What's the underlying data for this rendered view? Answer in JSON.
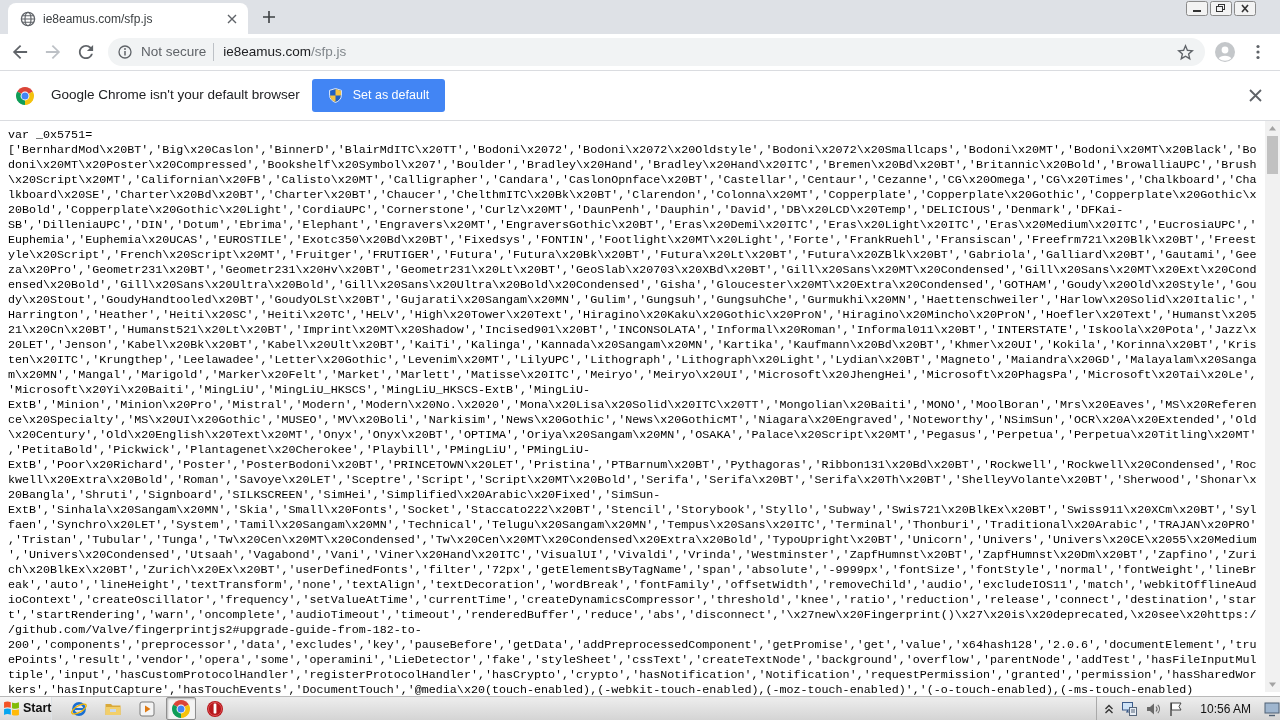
{
  "tabs": [
    {
      "title": "ie8eamus.com/sfp.js",
      "selected": true
    }
  ],
  "toolbar": {
    "nav_buttons": [
      {
        "kind": "back",
        "disabled": false
      },
      {
        "kind": "forward",
        "disabled": true
      },
      {
        "kind": "reload",
        "disabled": false
      }
    ],
    "address_bar": {
      "security_label": "Not secure",
      "host": "ie8eamus.com",
      "path": "/sfp.js"
    }
  },
  "infobar": {
    "message": "Google Chrome isn't your default browser",
    "button": "Set as default"
  },
  "document": {
    "lines": [
      "var _0x5751=",
      "['BernhardMod\\x20BT','Big\\x20Caslon','BinnerD','BlairMdITC\\x20TT','Bodoni\\x2072','Bodoni\\x2072\\x20Oldstyle','Bodoni\\x2072\\x20Smallcaps','Bodoni\\x20MT','Bodoni\\x20MT\\x20Black','Bo",
      "doni\\x20MT\\x20Poster\\x20Compressed','Bookshelf\\x20Symbol\\x207','Boulder','Bradley\\x20Hand','Bradley\\x20Hand\\x20ITC','Bremen\\x20Bd\\x20BT','Britannic\\x20Bold','BrowalliaUPC','Brush",
      "\\x20Script\\x20MT','Californian\\x20FB','Calisto\\x20MT','Calligrapher','Candara','CaslonOpnface\\x20BT','Castellar','Centaur','Cezanne','CG\\x20Omega','CG\\x20Times','Chalkboard','Cha",
      "lkboard\\x20SE','Charter\\x20Bd\\x20BT','Charter\\x20BT','Chaucer','ChelthmITC\\x20Bk\\x20BT','Clarendon','Colonna\\x20MT','Copperplate','Copperplate\\x20Gothic','Copperplate\\x20Gothic\\x",
      "20Bold','Copperplate\\x20Gothic\\x20Light','CordiaUPC','Cornerstone','Curlz\\x20MT','DaunPenh','Dauphin','David','DB\\x20LCD\\x20Temp','DELICIOUS','Denmark','DFKai-",
      "SB','DilleniaUPC','DIN','Dotum','Ebrima','Elephant','Engravers\\x20MT','EngraversGothic\\x20BT','Eras\\x20Demi\\x20ITC','Eras\\x20Light\\x20ITC','Eras\\x20Medium\\x20ITC','EucrosiaUPC','",
      "Euphemia','Euphemia\\x20UCAS','EUROSTILE','Exotc350\\x20Bd\\x20BT','Fixedsys','FONTIN','Footlight\\x20MT\\x20Light','Forte','FrankRuehl','Fransiscan','Freefrm721\\x20Blk\\x20BT','Freest",
      "yle\\x20Script','French\\x20Script\\x20MT','Fruitger','FRUTIGER','Futura','Futura\\x20Bk\\x20BT','Futura\\x20Lt\\x20BT','Futura\\x20ZBlk\\x20BT','Gabriola','Galliard\\x20BT','Gautami','Gee",
      "za\\x20Pro','Geometr231\\x20BT','Geometr231\\x20Hv\\x20BT','Geometr231\\x20Lt\\x20BT','GeoSlab\\x20703\\x20XBd\\x20BT','Gill\\x20Sans\\x20MT\\x20Condensed','Gill\\x20Sans\\x20MT\\x20Ext\\x20Cond",
      "ensed\\x20Bold','Gill\\x20Sans\\x20Ultra\\x20Bold','Gill\\x20Sans\\x20Ultra\\x20Bold\\x20Condensed','Gisha','Gloucester\\x20MT\\x20Extra\\x20Condensed','GOTHAM','Goudy\\x20Old\\x20Style','Gou",
      "dy\\x20Stout','GoudyHandtooled\\x20BT','GoudyOLSt\\x20BT','Gujarati\\x20Sangam\\x20MN','Gulim','Gungsuh','GungsuhChe','Gurmukhi\\x20MN','Haettenschweiler','Harlow\\x20Solid\\x20Italic','",
      "Harrington','Heather','Heiti\\x20SC','Heiti\\x20TC','HELV','High\\x20Tower\\x20Text','Hiragino\\x20Kaku\\x20Gothic\\x20ProN','Hiragino\\x20Mincho\\x20ProN','Hoefler\\x20Text','Humanst\\x205",
      "21\\x20Cn\\x20BT','Humanst521\\x20Lt\\x20BT','Imprint\\x20MT\\x20Shadow','Incised901\\x20BT','INCONSOLATA','Informal\\x20Roman','Informal011\\x20BT','INTERSTATE','Iskoola\\x20Pota','Jazz\\x",
      "20LET','Jenson','Kabel\\x20Bk\\x20BT','Kabel\\x20Ult\\x20BT','KaiTi','Kalinga','Kannada\\x20Sangam\\x20MN','Kartika','Kaufmann\\x20Bd\\x20BT','Khmer\\x20UI','Kokila','Korinna\\x20BT','Kris",
      "ten\\x20ITC','Krungthep','Leelawadee','Letter\\x20Gothic','Levenim\\x20MT','LilyUPC','Lithograph','Lithograph\\x20Light','Lydian\\x20BT','Magneto','Maiandra\\x20GD','Malayalam\\x20Sanga",
      "m\\x20MN','Mangal','Marigold','Marker\\x20Felt','Market','Marlett','Matisse\\x20ITC','Meiryo','Meiryo\\x20UI','Microsoft\\x20JhengHei','Microsoft\\x20PhagsPa','Microsoft\\x20Tai\\x20Le',",
      "'Microsoft\\x20Yi\\x20Baiti','MingLiU','MingLiU_HKSCS','MingLiU_HKSCS-ExtB','MingLiU-",
      "ExtB','Minion','Minion\\x20Pro','Mistral','Modern','Modern\\x20No.\\x2020','Mona\\x20Lisa\\x20Solid\\x20ITC\\x20TT','Mongolian\\x20Baiti','MONO','MoolBoran','Mrs\\x20Eaves','MS\\x20Referen",
      "ce\\x20Specialty','MS\\x20UI\\x20Gothic','MUSEO','MV\\x20Boli','Narkisim','News\\x20Gothic','News\\x20GothicMT','Niagara\\x20Engraved','Noteworthy','NSimSun','OCR\\x20A\\x20Extended','Old",
      "\\x20Century','Old\\x20English\\x20Text\\x20MT','Onyx','Onyx\\x20BT','OPTIMA','Oriya\\x20Sangam\\x20MN','OSAKA','Palace\\x20Script\\x20MT','Pegasus','Perpetua','Perpetua\\x20Titling\\x20MT'",
      ",'PetitaBold','Pickwick','Plantagenet\\x20Cherokee','Playbill','PMingLiU','PMingLiU-",
      "ExtB','Poor\\x20Richard','Poster','PosterBodoni\\x20BT','PRINCETOWN\\x20LET','Pristina','PTBarnum\\x20BT','Pythagoras','Ribbon131\\x20Bd\\x20BT','Rockwell','Rockwell\\x20Condensed','Roc",
      "kwell\\x20Extra\\x20Bold','Roman','Savoye\\x20LET','Sceptre','Script','Script\\x20MT\\x20Bold','Serifa','Serifa\\x20BT','Serifa\\x20Th\\x20BT','ShelleyVolante\\x20BT','Sherwood','Shonar\\x",
      "20Bangla','Shruti','Signboard','SILKSCREEN','SimHei','Simplified\\x20Arabic\\x20Fixed','SimSun-",
      "ExtB','Sinhala\\x20Sangam\\x20MN','Skia','Small\\x20Fonts','Socket','Staccato222\\x20BT','Stencil','Storybook','Styllo','Subway','Swis721\\x20BlkEx\\x20BT','Swiss911\\x20XCm\\x20BT','Syl",
      "faen','Synchro\\x20LET','System','Tamil\\x20Sangam\\x20MN','Technical','Telugu\\x20Sangam\\x20MN','Tempus\\x20Sans\\x20ITC','Terminal','Thonburi','Traditional\\x20Arabic','TRAJAN\\x20PRO'",
      ",'Tristan','Tubular','Tunga','Tw\\x20Cen\\x20MT\\x20Condensed','Tw\\x20Cen\\x20MT\\x20Condensed\\x20Extra\\x20Bold','TypoUpright\\x20BT','Unicorn','Univers','Univers\\x20CE\\x2055\\x20Medium",
      "','Univers\\x20Condensed','Utsaah','Vagabond','Vani','Viner\\x20Hand\\x20ITC','VisualUI','Vivaldi','Vrinda','Westminster','ZapfHumnst\\x20BT','ZapfHumnst\\x20Dm\\x20BT','Zapfino','Zuri",
      "ch\\x20BlkEx\\x20BT','Zurich\\x20Ex\\x20BT','userDefinedFonts','filter','72px','getElementsByTagName','span','absolute','-9999px','fontSize','fontStyle','normal','fontWeight','lineBr",
      "eak','auto','lineHeight','textTransform','none','textAlign','textDecoration','wordBreak','fontFamily','offsetWidth','removeChild','audio','excludeIOS11','match','webkitOfflineAud",
      "ioContext','createOscillator','frequency','setValueAtTime','currentTime','createDynamicsCompressor','threshold','knee','ratio','reduction','release','connect','destination','star",
      "t','startRendering','warn','oncomplete','audioTimeout','timeout','renderedBuffer','reduce','abs','disconnect','\\x27new\\x20Fingerprint()\\x27\\x20is\\x20deprecated,\\x20see\\x20https:/",
      "/github.com/Valve/fingerprintjs2#upgrade-guide-from-182-to-",
      "200','components','preprocessor','data','excludes','key','pauseBefore','getData','addPreprocessedComponent','getPromise','get','value','x64hash128','2.0.6','documentElement','tru",
      "ePoints','result','vendor','opera','some','operamini','LieDetector','fake','styleSheet','cssText','createTextNode','background','overflow','parentNode','addTest','hasFileInputMul",
      "tiple','input','hasCustomProtocolHandler','registerProtocolHandler','hasCrypto','crypto','hasNotification','Notification','requestPermission','granted','permission','hasSharedWor",
      "kers','hasInputCapture','hasTouchEvents','DocumentTouch','@media\\x20(touch-enabled),(-webkit-touch-enabled),(-moz-touch-enabled)','(-o-touch-enabled),(-ms-touch-enabled)"
    ]
  },
  "taskbar": {
    "start_label": "Start",
    "apps": [
      {
        "kind": "globe",
        "selected": false
      },
      {
        "kind": "folder",
        "selected": false
      },
      {
        "kind": "player",
        "selected": false
      },
      {
        "kind": "browser",
        "selected": true
      },
      {
        "kind": "alert",
        "selected": false
      }
    ],
    "clock": "10:56 AM"
  }
}
